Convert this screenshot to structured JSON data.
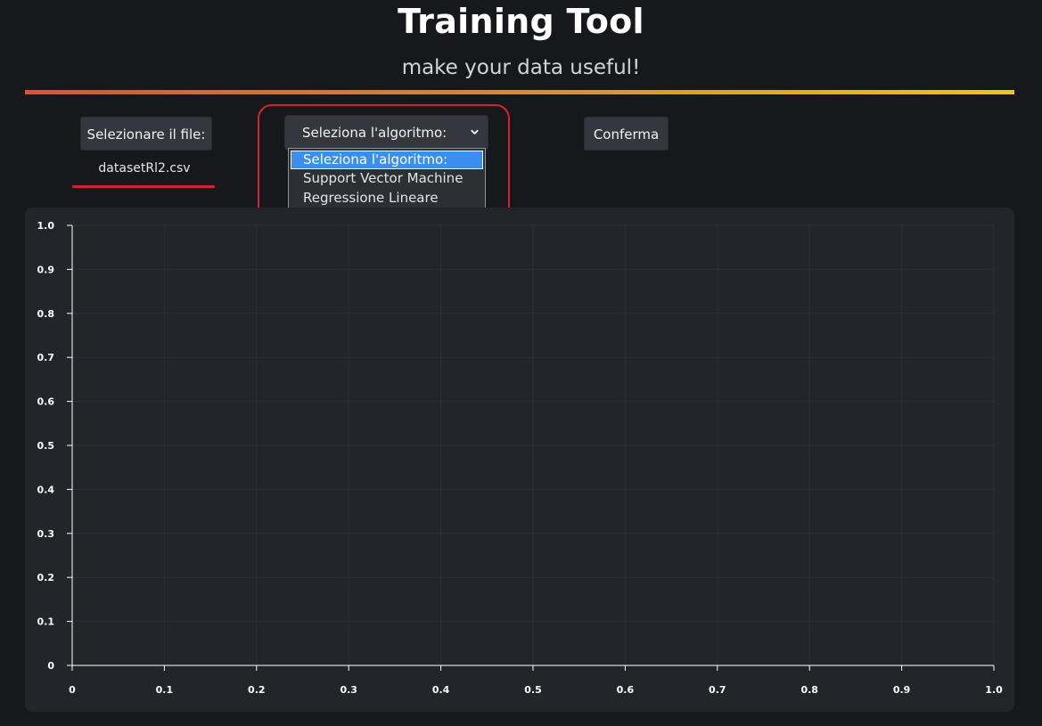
{
  "header": {
    "title": "Training Tool",
    "subtitle": "make your data useful!"
  },
  "controls": {
    "file_button_label": "Selezionare il file:",
    "selected_file": "datasetRl2.csv",
    "algorithm_select": {
      "value": "Seleziona l'algoritmo:",
      "options": [
        "Seleziona l'algoritmo:",
        "Support Vector Machine",
        "Regressione Lineare"
      ],
      "highlighted_index": 0
    },
    "confirm_button_label": "Conferma"
  },
  "colors": {
    "background": "#17181b",
    "panel": "#22252a",
    "button": "#34373d",
    "accent_red": "#dc1f2a",
    "gradient_start": "#e2521d",
    "gradient_end": "#f2c21b",
    "dropdown_highlight": "#3a8ef0"
  },
  "chart_data": {
    "type": "scatter",
    "title": "",
    "xlabel": "",
    "ylabel": "",
    "xlim": [
      0,
      1
    ],
    "ylim": [
      0,
      1
    ],
    "x_ticks": [
      "0",
      "0.1",
      "0.2",
      "0.3",
      "0.4",
      "0.5",
      "0.6",
      "0.7",
      "0.8",
      "0.9",
      "1.0"
    ],
    "y_ticks": [
      "0",
      "0.1",
      "0.2",
      "0.3",
      "0.4",
      "0.5",
      "0.6",
      "0.7",
      "0.8",
      "0.9",
      "1.0"
    ],
    "grid": true,
    "series": []
  }
}
